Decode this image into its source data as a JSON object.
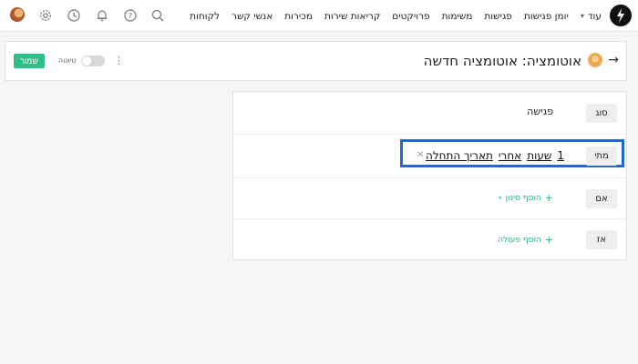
{
  "nav": {
    "items": [
      "לקוחות",
      "אנשי קשר",
      "מכירות",
      "קריאות שירות",
      "פרויקטים",
      "משימות",
      "פגישות",
      "יומן פגישות"
    ],
    "more_label": "עוד"
  },
  "header": {
    "title": "אוטומציה: אוטומציה חדשה",
    "draft_label": "טיוטה",
    "save_label": "שמור"
  },
  "automation": {
    "type": {
      "label": "סוג",
      "value": "פגישה"
    },
    "when": {
      "label": "מתי",
      "tokens": [
        "1",
        "שעות",
        "אחרי",
        "תאריך התחלה"
      ]
    },
    "if": {
      "label": "אם",
      "add_filter": "הוסף סינון"
    },
    "then": {
      "label": "אז",
      "add_action": "הוסף פעולה"
    }
  },
  "colors": {
    "accent": "#2bbf8a",
    "highlight": "#1f69d6",
    "automation_icon": "#f0a94c"
  }
}
